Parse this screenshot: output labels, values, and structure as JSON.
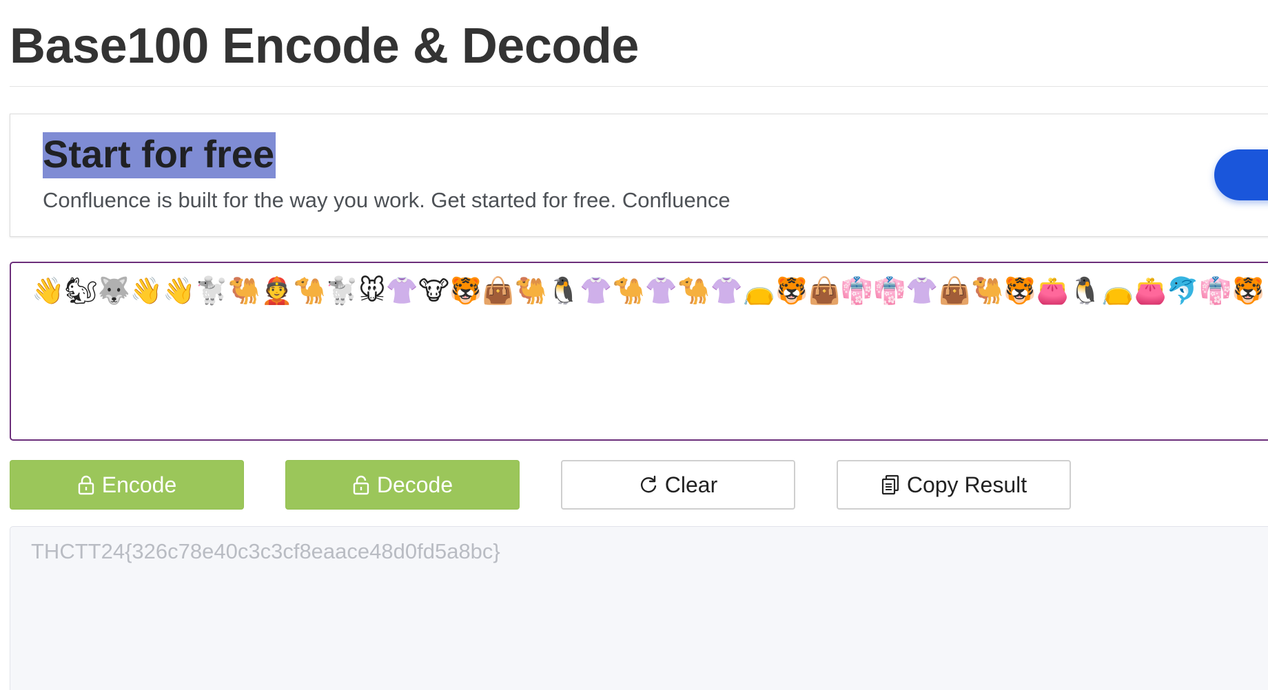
{
  "page": {
    "title": "Base100 Encode & Decode"
  },
  "ad": {
    "headline": "Start for free",
    "description": "Confluence is built for the way you work. Get started for free. Confluence",
    "cta_label": ""
  },
  "input": {
    "value": "👋🐿🐺👋👋🐩🐫👲🐪🐩🐭👚🐮🐯👜🐫🐧👚🐪👚🐪👚👝🐯👜👘👘👚👜🐫🐯👛🐧👝👛🐬👘🐯👙👚👴"
  },
  "buttons": {
    "encode": {
      "label": "Encode",
      "icon": "lock-icon"
    },
    "decode": {
      "label": "Decode",
      "icon": "unlock-icon"
    },
    "clear": {
      "label": "Clear",
      "icon": "refresh-icon"
    },
    "copy": {
      "label": "Copy Result",
      "icon": "copy-icon"
    }
  },
  "output": {
    "value": "THCTT24{326c78e40c3c3cf8eaace48d0fd5a8bc}"
  },
  "colors": {
    "green_button": "#9bc65a",
    "input_border": "#6b2e7a",
    "cta_blue": "#1a56db",
    "highlight": "#7f8cd4"
  }
}
